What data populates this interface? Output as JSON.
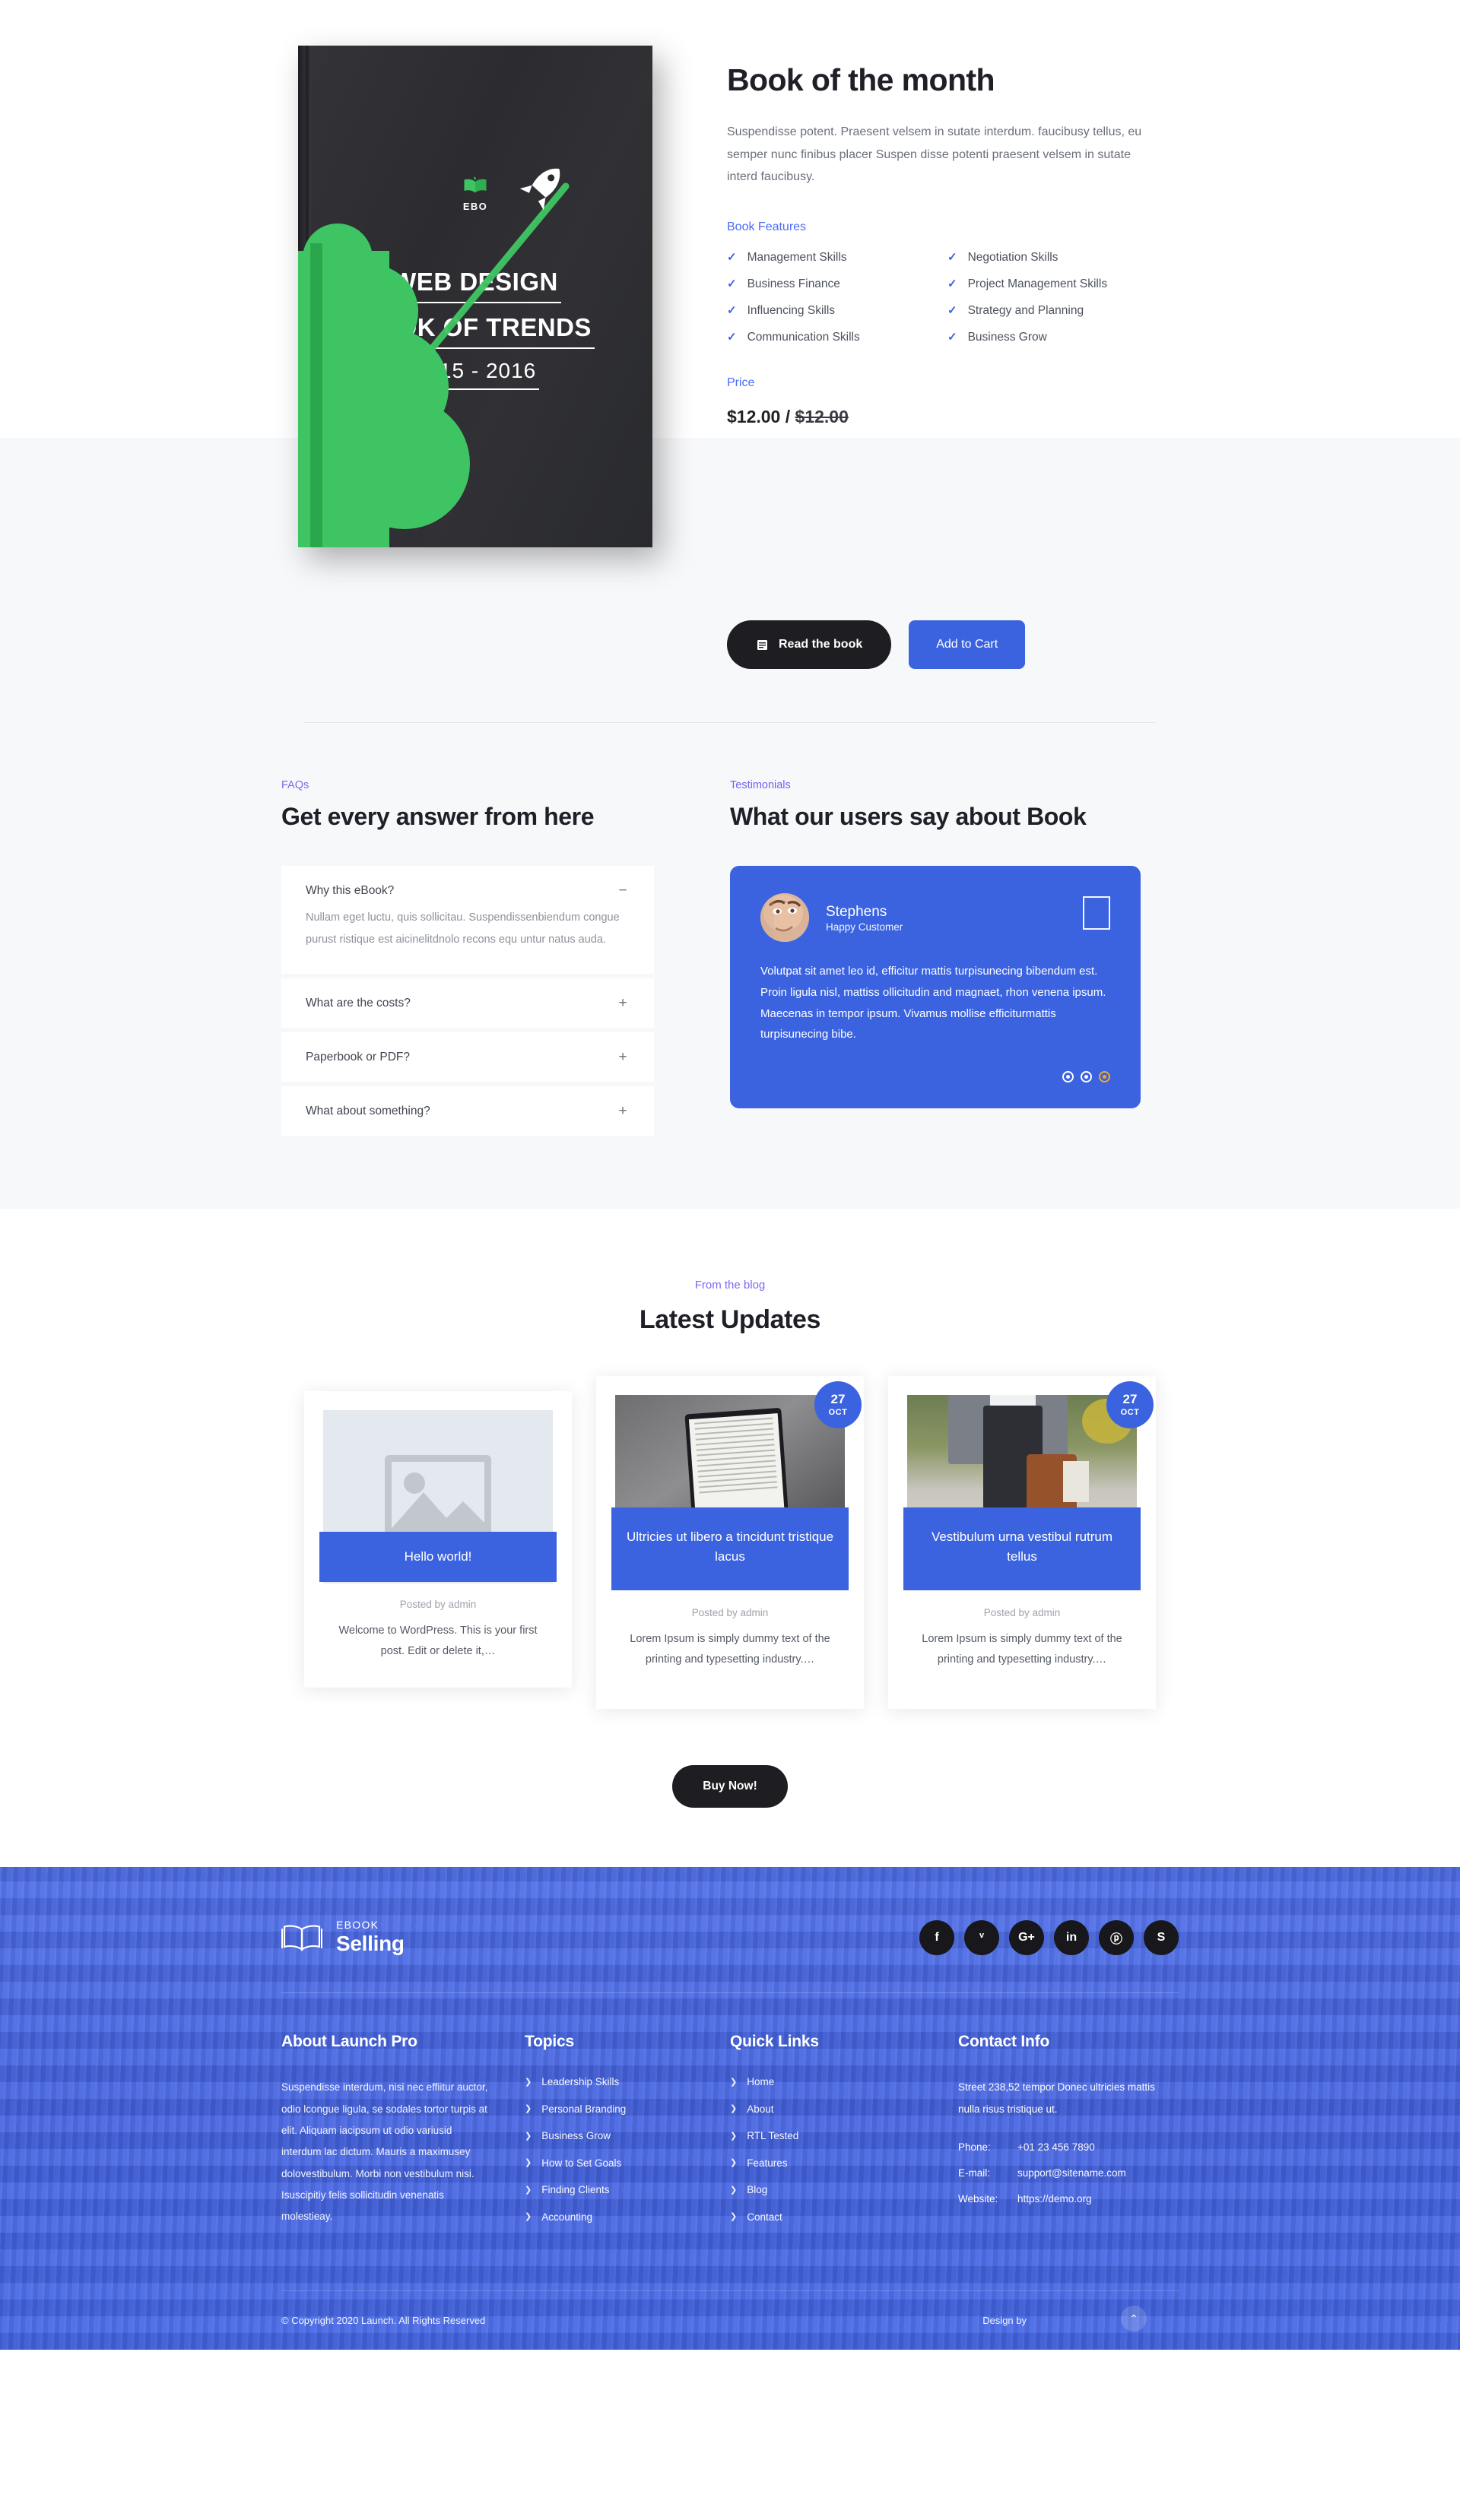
{
  "hero": {
    "book": {
      "logo_label": "EBO",
      "title_line1": "WEB DESIGN",
      "title_line2": "BOOK OF TRENDS",
      "title_line3": "2015 - 2016"
    },
    "title": "Book of the month",
    "description": "Suspendisse potent. Praesent velsem in sutate interdum. faucibusy tellus, eu semper nunc finibus placer Suspen disse potenti praesent velsem in sutate interd faucibusy.",
    "features_label": "Book Features",
    "features": [
      "Management Skills",
      "Business Finance",
      "Influencing Skills",
      "Communication Skills",
      "Negotiation Skills",
      "Project Management Skills",
      "Strategy and Planning",
      "Business Grow"
    ],
    "price_label": "Price",
    "price_current": "$12.00",
    "price_separator": "/",
    "price_old": "$12.00",
    "read_button": "Read the book",
    "cart_button": "Add to Cart"
  },
  "faq": {
    "eyebrow": "FAQs",
    "title": "Get every answer from here",
    "items": [
      {
        "q": "Why this eBook?",
        "a": "Nullam eget luctu, quis sollicitau. Suspendissenbiendum congue purust ristique est aicinelitdnolo recons equ untur natus auda.",
        "sign": "−",
        "open": true
      },
      {
        "q": "What are the costs?",
        "a": "",
        "sign": "+",
        "open": false
      },
      {
        "q": "Paperbook or PDF?",
        "a": "",
        "sign": "+",
        "open": false
      },
      {
        "q": "What about something?",
        "a": "",
        "sign": "+",
        "open": false
      }
    ]
  },
  "testimonials": {
    "eyebrow": "Testimonials",
    "title": "What our users say about Book",
    "card": {
      "name": "Stephens",
      "role": "Happy Customer",
      "body": "Volutpat sit amet leo id, efficitur mattis turpisunecing bibendum est. Proin ligula nisl, mattiss ollicitudin and magnaet, rhon venena ipsum. Maecenas in tempor ipsum. Vivamus mollise efficiturmattis turpisunecing bibe."
    },
    "dots": 3,
    "active_dot": 3
  },
  "blog": {
    "eyebrow": "From the blog",
    "title": "Latest Updates",
    "posts": [
      {
        "image_kind": "placeholder",
        "has_date": false,
        "date_day": "",
        "date_month": "",
        "title": "Hello world!",
        "posted": "Posted by admin",
        "excerpt": "Welcome to WordPress. This is your first post. Edit or delete it,…"
      },
      {
        "image_kind": "tablet",
        "has_date": true,
        "date_day": "27",
        "date_month": "OCT",
        "title": "Ultricies ut libero a tincidunt tristique lacus",
        "posted": "Posted by admin",
        "excerpt": "Lorem Ipsum is simply dummy text of the printing and typesetting industry.…"
      },
      {
        "image_kind": "walk",
        "has_date": true,
        "date_day": "27",
        "date_month": "OCT",
        "title": "Vestibulum urna vestibul rutrum tellus",
        "posted": "Posted by admin",
        "excerpt": "Lorem Ipsum is simply dummy text of the printing and typesetting industry.…"
      }
    ],
    "buy_button": "Buy Now!"
  },
  "footer": {
    "logo_small": "EBOOK",
    "logo_big": "Selling",
    "socials": [
      {
        "name": "facebook",
        "glyph": "f"
      },
      {
        "name": "twitter",
        "glyph": "ᵛ"
      },
      {
        "name": "google-plus",
        "glyph": "G+"
      },
      {
        "name": "linkedin",
        "glyph": "in"
      },
      {
        "name": "pinterest",
        "glyph": "ⓟ"
      },
      {
        "name": "skype",
        "glyph": "S"
      }
    ],
    "about": {
      "heading": "About Launch Pro",
      "text": "Suspendisse interdum, nisi nec effiitur auctor, odio lcongue ligula, se sodales tortor turpis at elit. Aliquam iacipsum ut odio variusid interdum lac dictum. Mauris a maximusey dolovestibulum. Morbi non vestibulum nisi. Isuscipitiy felis sollicitudin venenatis molestieay."
    },
    "topics": {
      "heading": "Topics",
      "items": [
        "Leadership Skills",
        "Personal Branding",
        "Business Grow",
        "How to Set Goals",
        "Finding Clients",
        "Accounting"
      ]
    },
    "quick_links": {
      "heading": "Quick Links",
      "items": [
        "Home",
        "About",
        "RTL Tested",
        "Features",
        "Blog",
        "Contact"
      ]
    },
    "contact": {
      "heading": "Contact Info",
      "address": "Street 238,52 tempor Donec ultricies mattis nulla risus tristique ut.",
      "rows": [
        {
          "key": "Phone:",
          "value": "+01 23 456 7890"
        },
        {
          "key": "E-mail:",
          "value": "support@sitename.com"
        },
        {
          "key": "Website:",
          "value": "https://demo.org"
        }
      ]
    },
    "copyright": "© Copyright 2020 Launch. All Rights Reserved",
    "design_by": "Design by",
    "to_top": "⌃"
  },
  "colors": {
    "accent_blue": "#3b63e0",
    "purple": "#7b68f2",
    "dark": "#1d1d22",
    "footer_blue": "#4a6ae8",
    "green": "#3fc463",
    "amber": "#f4a81d"
  }
}
